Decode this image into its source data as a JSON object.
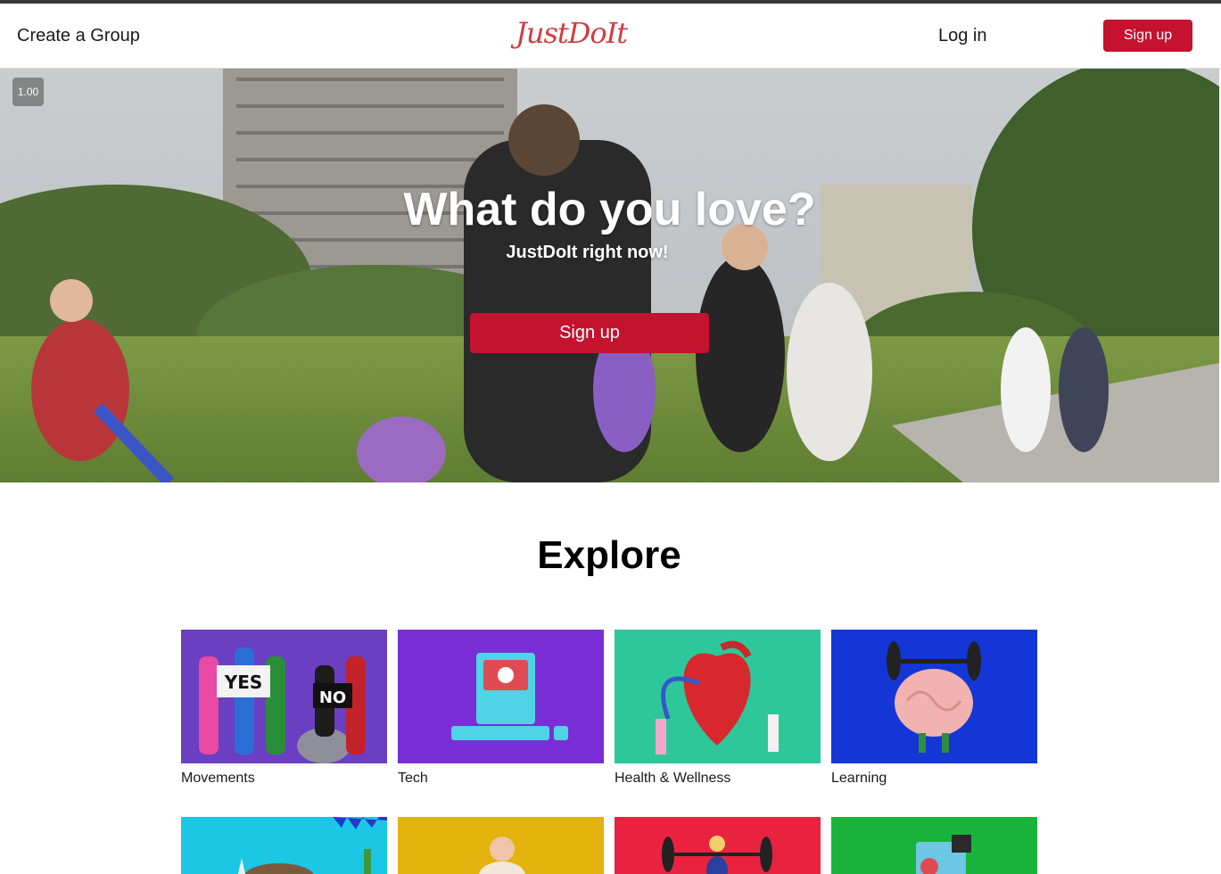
{
  "header": {
    "create_group": "Create a Group",
    "logo": "JustDoIt",
    "login": "Log in",
    "signup": "Sign up"
  },
  "hero": {
    "speed": "1.00",
    "title": "What do you love?",
    "subtitle": "JustDoIt right now!",
    "signup": "Sign up"
  },
  "explore": {
    "title": "Explore",
    "categories": [
      {
        "label": "Movements",
        "bg": "#6b3fc2"
      },
      {
        "label": "Tech",
        "bg": "#7a2fd6"
      },
      {
        "label": "Health & Wellness",
        "bg": "#2ec79a"
      },
      {
        "label": "Learning",
        "bg": "#1436d6"
      }
    ],
    "row2": [
      {
        "bg": "#1cc7e6"
      },
      {
        "bg": "#e3b30e"
      },
      {
        "bg": "#e8223f"
      },
      {
        "bg": "#19b33c"
      }
    ]
  },
  "colors": {
    "brand_red": "#c4122f",
    "logo_red": "#d43a40"
  }
}
